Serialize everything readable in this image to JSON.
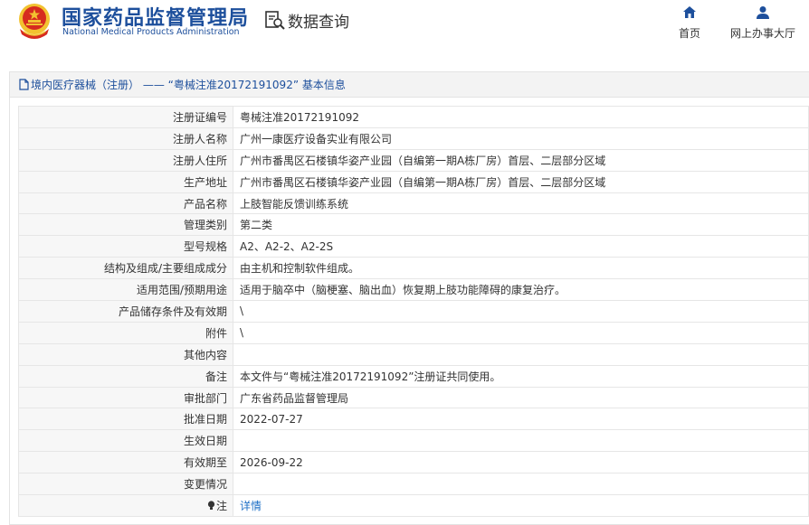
{
  "header": {
    "org_name_cn": "国家药品监督管理局",
    "org_name_en": "National Medical Products Administration",
    "query_label": "数据查询",
    "nav": {
      "home_label": "首页",
      "hall_label": "网上办事大厅"
    }
  },
  "panel": {
    "title": "境内医疗器械（注册） —— “粤械注准20172191092” 基本信息"
  },
  "record": {
    "rows": [
      {
        "label": "注册证编号",
        "value": "粤械注准20172191092"
      },
      {
        "label": "注册人名称",
        "value": "广州一康医疗设备实业有限公司"
      },
      {
        "label": "注册人住所",
        "value": "广州市番禺区石楼镇华姿产业园（自编第一期A栋厂房）首层、二层部分区域"
      },
      {
        "label": "生产地址",
        "value": "广州市番禺区石楼镇华姿产业园（自编第一期A栋厂房）首层、二层部分区域"
      },
      {
        "label": "产品名称",
        "value": "上肢智能反馈训练系统"
      },
      {
        "label": "管理类别",
        "value": "第二类"
      },
      {
        "label": "型号规格",
        "value": "A2、A2-2、A2-2S"
      },
      {
        "label": "结构及组成/主要组成成分",
        "value": "由主机和控制软件组成。"
      },
      {
        "label": "适用范围/预期用途",
        "value": "适用于脑卒中（脑梗塞、脑出血）恢复期上肢功能障碍的康复治疗。"
      },
      {
        "label": "产品储存条件及有效期",
        "value": "\\"
      },
      {
        "label": "附件",
        "value": "\\"
      },
      {
        "label": "其他内容",
        "value": ""
      },
      {
        "label": "备注",
        "value": "本文件与“粤械注准20172191092”注册证共同使用。"
      },
      {
        "label": "审批部门",
        "value": "广东省药品监督管理局"
      },
      {
        "label": "批准日期",
        "value": "2022-07-27"
      },
      {
        "label": "生效日期",
        "value": ""
      },
      {
        "label": "有效期至",
        "value": "2026-09-22"
      },
      {
        "label": "变更情况",
        "value": ""
      }
    ],
    "note": {
      "label": "注",
      "link": "详情"
    }
  },
  "colors": {
    "brand_blue": "#1d4f9c",
    "link_blue": "#1d6fc6",
    "emblem_red": "#d62b1f",
    "emblem_gold": "#f2c230"
  }
}
